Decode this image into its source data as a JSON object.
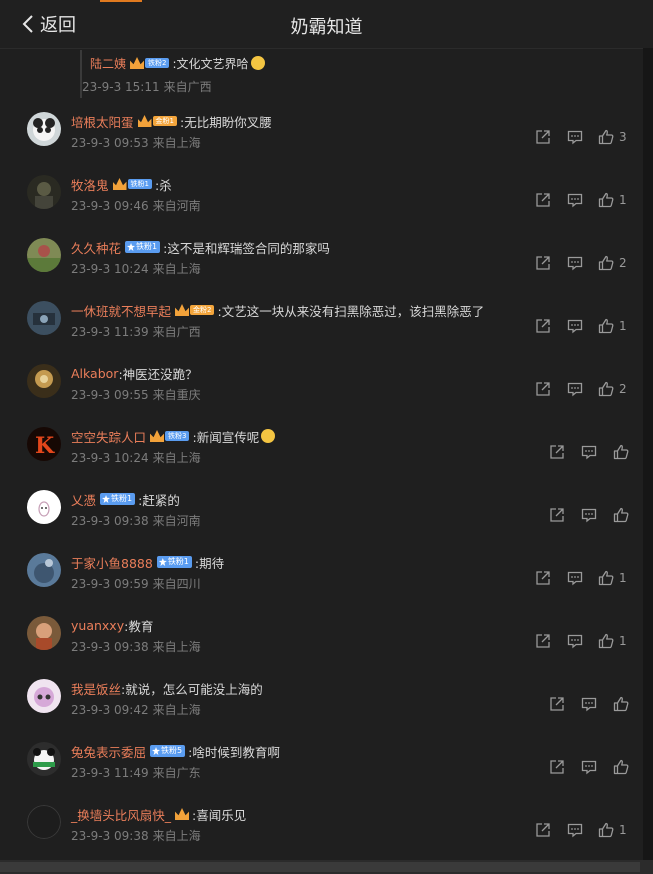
{
  "header": {
    "back_label": "返回",
    "title": "奶霸知道"
  },
  "reply": {
    "user": "陆二姨",
    "badge": "铁粉2",
    "text": ":文化文艺界哈",
    "time": "23-9-3 15:11",
    "location": "来自广西"
  },
  "comments": [
    {
      "user": "培根太阳蛋",
      "badge": "金粉1",
      "text": ":无比期盼你叉腰",
      "time": "23-9-3 09:53",
      "location": "来自上海",
      "likes": "3"
    },
    {
      "user": "牧洛鬼",
      "badge": "铁粉1",
      "text": ":杀",
      "time": "23-9-3 09:46",
      "location": "来自河南",
      "likes": "1"
    },
    {
      "user": "久久种花",
      "badge": "铁粉1",
      "text": ":这不是和辉瑞签合同的那家吗",
      "time": "23-9-3 10:24",
      "location": "来自上海",
      "likes": "2"
    },
    {
      "user": "一休班就不想早起",
      "badge": "金粉2",
      "text": ":文艺这一块从来没有扫黑除恶过，该扫黑除恶了",
      "time": "23-9-3 11:39",
      "location": "来自广西",
      "likes": "1"
    },
    {
      "user": "Alkabor",
      "badge": "",
      "text": ":神医还没跪？",
      "time": "23-9-3 09:55",
      "location": "来自重庆",
      "likes": "2"
    },
    {
      "user": "空空失踪人口",
      "badge": "铁粉3",
      "text": ":新闻宣传呢",
      "time": "23-9-3 10:24",
      "location": "来自上海",
      "likes": ""
    },
    {
      "user": "乂憑",
      "badge": "铁粉1",
      "text": ":赶紧的",
      "time": "23-9-3 09:38",
      "location": "来自河南",
      "likes": ""
    },
    {
      "user": "于家小鱼8888",
      "badge": "铁粉1",
      "text": ":期待",
      "time": "23-9-3 09:59",
      "location": "来自四川",
      "likes": "1"
    },
    {
      "user": "yuanxxy",
      "badge": "",
      "text": ":教育",
      "time": "23-9-3 09:38",
      "location": "来自上海",
      "likes": "1"
    },
    {
      "user": "我是饭丝",
      "badge": "",
      "text": ":就说，怎么可能没上海的",
      "time": "23-9-3 09:42",
      "location": "来自上海",
      "likes": ""
    },
    {
      "user": "兔兔表示委屈",
      "badge": "铁粉5",
      "text": ":啥时候到教育啊",
      "time": "23-9-3 11:49",
      "location": "来自广东",
      "likes": ""
    },
    {
      "user": "_换墙头比风扇快_",
      "badge": "",
      "text": ":喜闻乐见",
      "time": "23-9-3 09:38",
      "location": "来自上海",
      "likes": "1"
    }
  ],
  "colors": {
    "background": "#1f1f1f",
    "username": "#ea7e5a",
    "meta": "#7c7c7c",
    "badge_blue": "#5a9cf0",
    "badge_gold": "#f3a53c"
  }
}
